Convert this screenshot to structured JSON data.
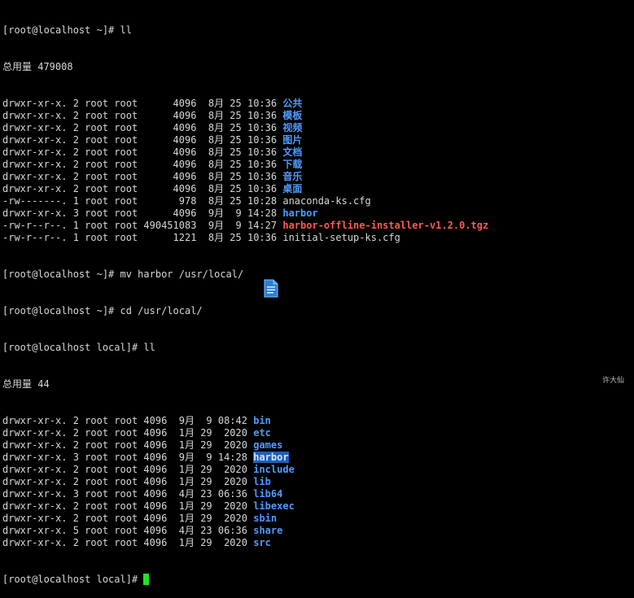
{
  "prompt_home": "[root@localhost ~]# ",
  "prompt_local": "[root@localhost local]# ",
  "cmd_ll": "ll",
  "total1": "总用量 479008",
  "listing1": [
    {
      "meta": "drwxr-xr-x. 2 root root      4096  8月 25 10:36 ",
      "name": "公共",
      "kind": "dir"
    },
    {
      "meta": "drwxr-xr-x. 2 root root      4096  8月 25 10:36 ",
      "name": "模板",
      "kind": "dir"
    },
    {
      "meta": "drwxr-xr-x. 2 root root      4096  8月 25 10:36 ",
      "name": "视频",
      "kind": "dir"
    },
    {
      "meta": "drwxr-xr-x. 2 root root      4096  8月 25 10:36 ",
      "name": "图片",
      "kind": "dir"
    },
    {
      "meta": "drwxr-xr-x. 2 root root      4096  8月 25 10:36 ",
      "name": "文档",
      "kind": "dir"
    },
    {
      "meta": "drwxr-xr-x. 2 root root      4096  8月 25 10:36 ",
      "name": "下载",
      "kind": "dir"
    },
    {
      "meta": "drwxr-xr-x. 2 root root      4096  8月 25 10:36 ",
      "name": "音乐",
      "kind": "dir"
    },
    {
      "meta": "drwxr-xr-x. 2 root root      4096  8月 25 10:36 ",
      "name": "桌面",
      "kind": "dir"
    },
    {
      "meta": "-rw-------. 1 root root       978  8月 25 10:28 ",
      "name": "anaconda-ks.cfg",
      "kind": "plain"
    },
    {
      "meta": "drwxr-xr-x. 3 root root      4096  9月  9 14:28 ",
      "name": "harbor",
      "kind": "dir"
    },
    {
      "meta": "-rw-r--r--. 1 root root 490451083  9月  9 14:27 ",
      "name": "harbor-offline-installer-v1.2.0.tgz",
      "kind": "archive"
    },
    {
      "meta": "-rw-r--r--. 1 root root      1221  8月 25 10:36 ",
      "name": "initial-setup-ks.cfg",
      "kind": "plain"
    }
  ],
  "cmd_mv": "mv harbor /usr/local/",
  "cmd_cd": "cd /usr/local/",
  "total2": "总用量 44",
  "listing2": [
    {
      "meta": "drwxr-xr-x. 2 root root 4096  9月  9 08:42 ",
      "name": "bin",
      "kind": "dir"
    },
    {
      "meta": "drwxr-xr-x. 2 root root 4096  1月 29  2020 ",
      "name": "etc",
      "kind": "dir"
    },
    {
      "meta": "drwxr-xr-x. 2 root root 4096  1月 29  2020 ",
      "name": "games",
      "kind": "dir"
    },
    {
      "meta": "drwxr-xr-x. 3 root root 4096  9月  9 14:28 ",
      "name": "harbor",
      "kind": "dir-selected"
    },
    {
      "meta": "drwxr-xr-x. 2 root root 4096  1月 29  2020 ",
      "name": "include",
      "kind": "dir"
    },
    {
      "meta": "drwxr-xr-x. 2 root root 4096  1月 29  2020 ",
      "name": "lib",
      "kind": "dir"
    },
    {
      "meta": "drwxr-xr-x. 3 root root 4096  4月 23 06:36 ",
      "name": "lib64",
      "kind": "dir"
    },
    {
      "meta": "drwxr-xr-x. 2 root root 4096  1月 29  2020 ",
      "name": "libexec",
      "kind": "dir"
    },
    {
      "meta": "drwxr-xr-x. 2 root root 4096  1月 29  2020 ",
      "name": "sbin",
      "kind": "dir"
    },
    {
      "meta": "drwxr-xr-x. 5 root root 4096  4月 23 06:36 ",
      "name": "share",
      "kind": "dir"
    },
    {
      "meta": "drwxr-xr-x. 2 root root 4096  1月 29  2020 ",
      "name": "src",
      "kind": "dir"
    }
  ],
  "watermark": "许大仙",
  "colors": {
    "background": "#000000",
    "text": "#d7d7d7",
    "directory": "#4f9bff",
    "archive": "#ff5a50",
    "cursor": "#21e321",
    "selection": "#1f5fb8"
  },
  "icons": {
    "drag_icon": "document-icon"
  }
}
